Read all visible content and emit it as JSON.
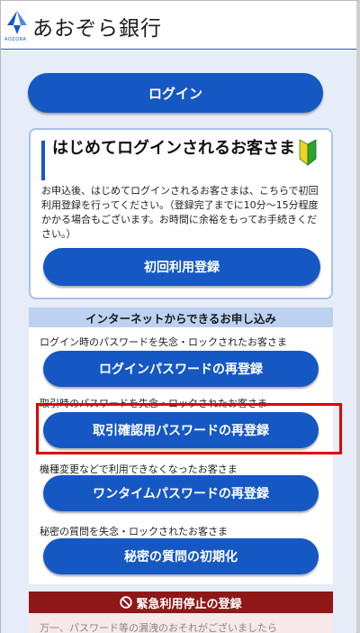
{
  "header": {
    "bank_name": "あおぞら銀行",
    "logo_sub": "AOZORA"
  },
  "login": {
    "label": "ログイン"
  },
  "first_time": {
    "title": "はじめてログインされるお客さま",
    "description": "お申込後、はじめてログインされるお客さまは、こちらで初回利用登録を行ってください。（登録完了までに10分～15分程度かかる場合もございます。お時間に余裕をもってお手続きください。）",
    "button_label": "初回利用登録"
  },
  "internet": {
    "section_title": "インターネットからできるお申し込み",
    "items": [
      {
        "caption": "ログイン時のパスワードを失念・ロックされたお客さま",
        "button_label": "ログインパスワードの再登録"
      },
      {
        "caption": "取引時のパスワードを失念・ロックされたお客さま",
        "button_label": "取引確認用パスワードの再登録"
      },
      {
        "caption": "機種変更などで利用できなくなったお客さま",
        "button_label": "ワンタイムパスワードの再登録"
      },
      {
        "caption": "秘密の質問を失念・ロックされたお客さま",
        "button_label": "秘密の質問の初期化"
      }
    ]
  },
  "emergency": {
    "title": "緊急利用停止の登録",
    "body_text": "万一、パスワード等の漏洩のおそれがございましたら"
  },
  "colors": {
    "primary_blue": "#1558c4",
    "highlight_red": "#e00000",
    "emergency_red": "#8e1818"
  }
}
